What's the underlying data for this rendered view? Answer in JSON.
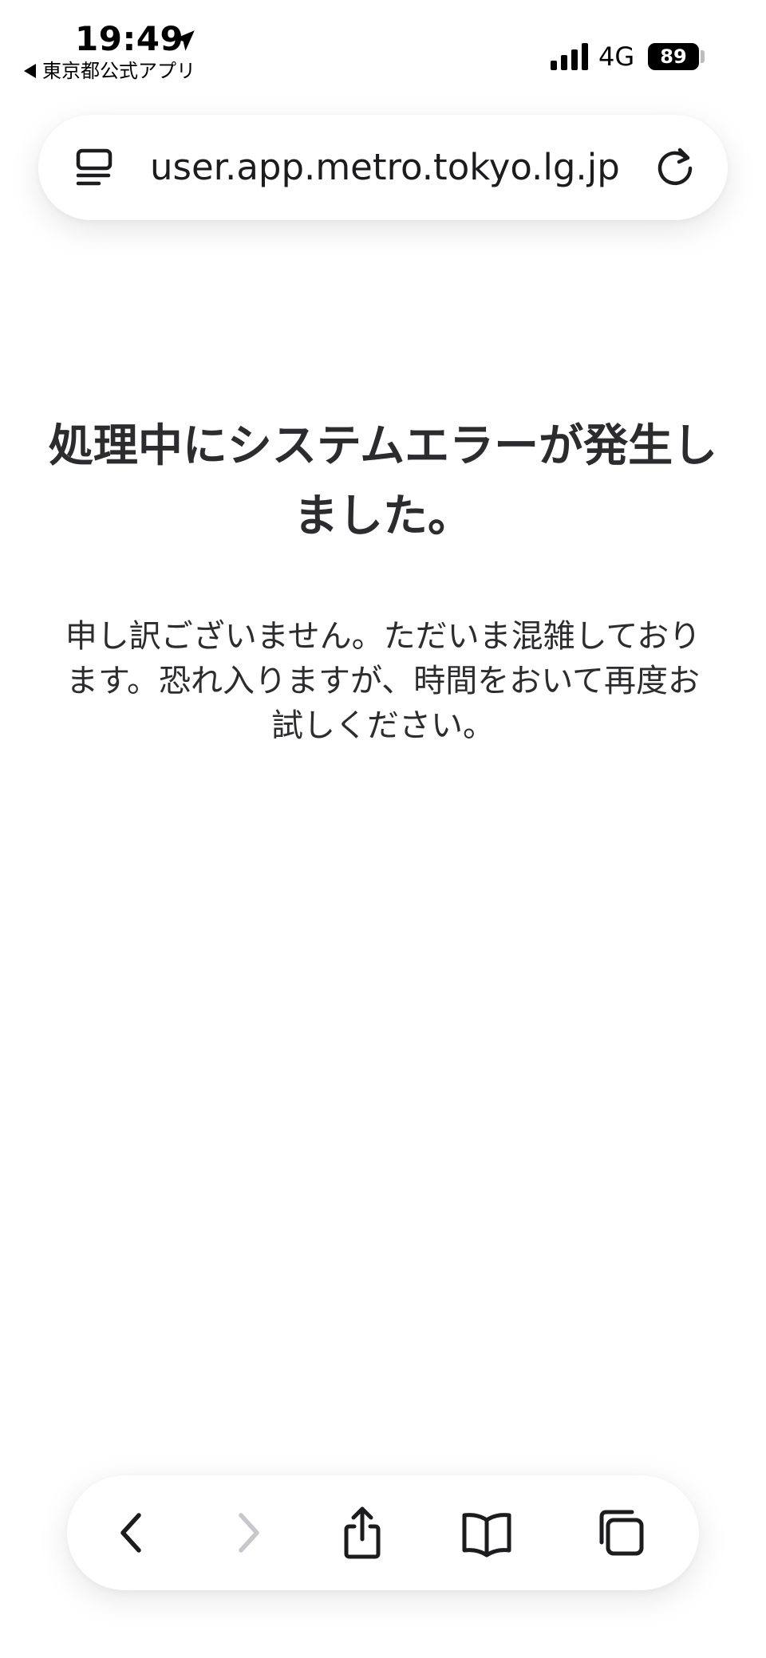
{
  "status_bar": {
    "time": "19:49",
    "back_app_label": "東京都公式アプリ",
    "network": "4G",
    "battery_level": "89"
  },
  "address_bar": {
    "url": "user.app.metro.tokyo.lg.jp"
  },
  "main": {
    "error_title": "処理中にシステムエラーが発生しました。",
    "error_message": "申し訳ございません。ただいま混雑しております。恐れ入りますが、時間をおいて再度お試しください。"
  },
  "toolbar": {
    "back_enabled": true,
    "forward_enabled": false
  },
  "icons": {
    "location": "location-arrow-icon",
    "signal": "cellular-signal-icon",
    "reader": "reader-mode-icon",
    "reload": "reload-icon",
    "back": "chevron-left-icon",
    "forward": "chevron-right-icon",
    "share": "share-icon",
    "bookmarks": "book-icon",
    "tabs": "tabs-icon"
  },
  "colors": {
    "text_primary": "#2c2c2e",
    "icon_active": "#1c1c1e",
    "icon_disabled": "#c7c7cc",
    "background": "#ffffff"
  }
}
